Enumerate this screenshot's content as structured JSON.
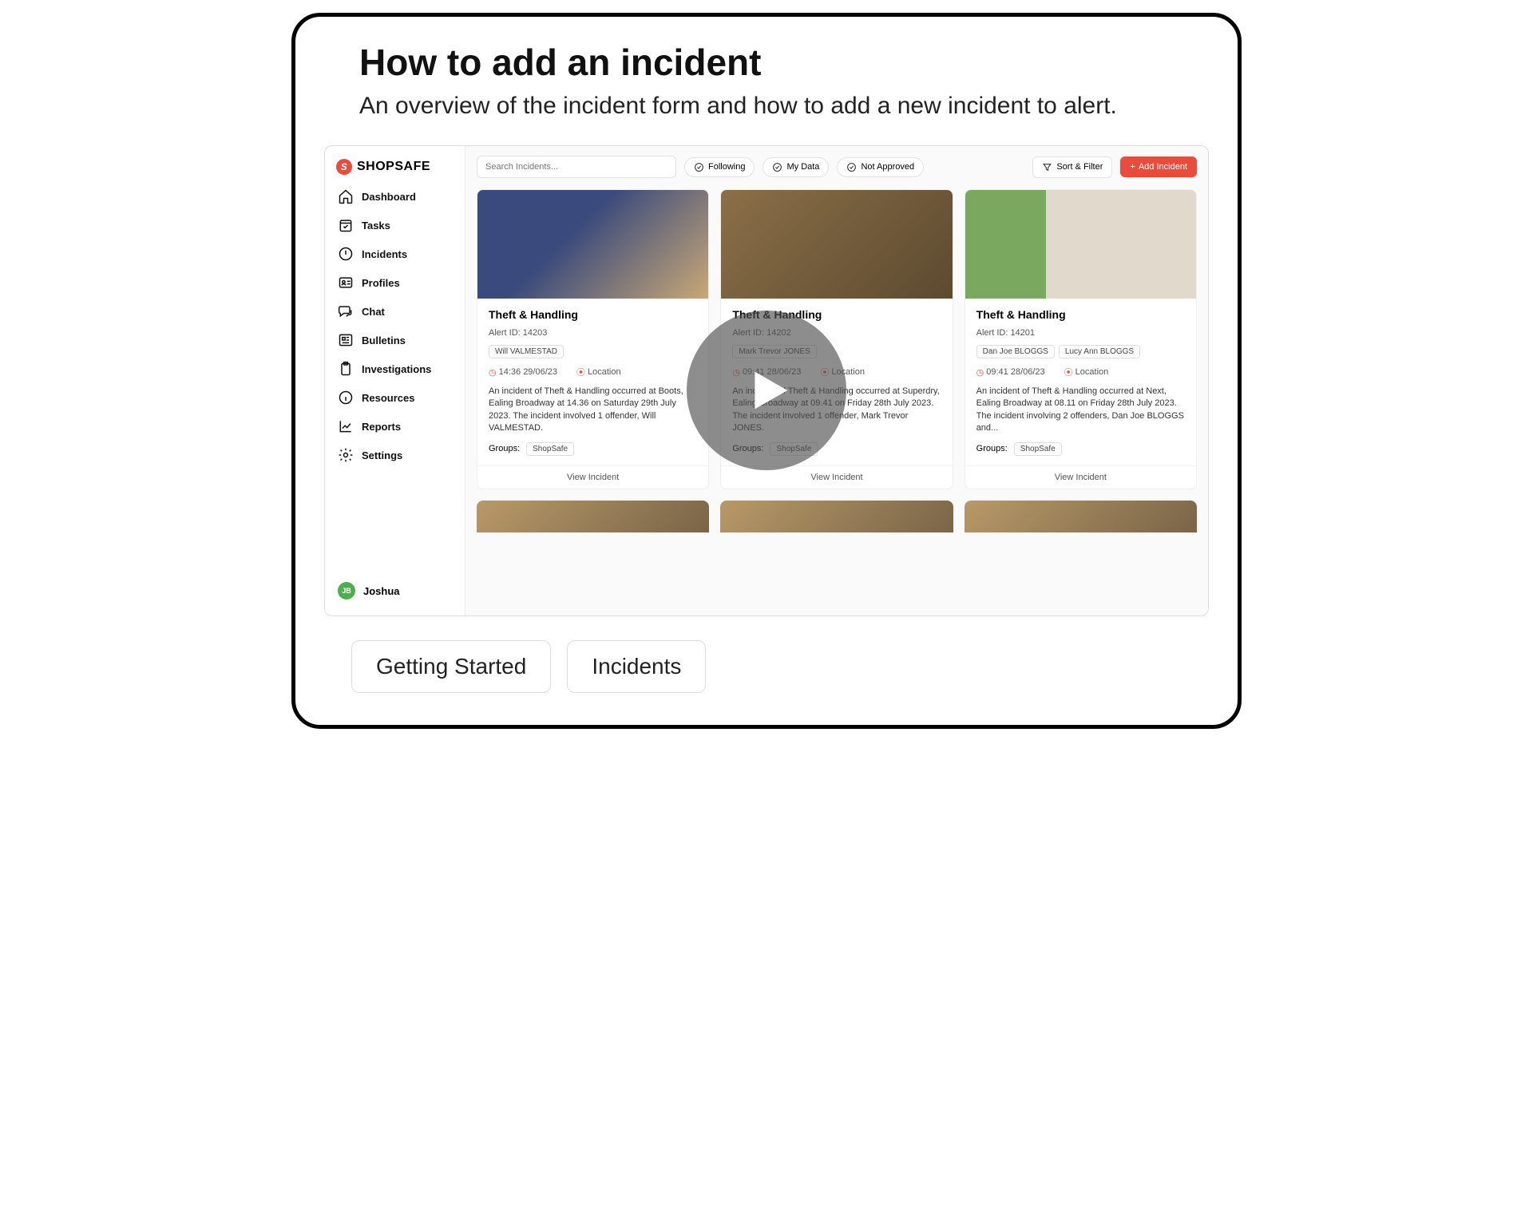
{
  "title": "How to add an incident",
  "subtitle": "An overview of the incident form and how to add a new incident to alert.",
  "brand": "SHOPSAFE",
  "nav": {
    "dashboard": "Dashboard",
    "tasks": "Tasks",
    "incidents": "Incidents",
    "profiles": "Profiles",
    "chat": "Chat",
    "bulletins": "Bulletins",
    "investigations": "Investigations",
    "resources": "Resources",
    "reports": "Reports",
    "settings": "Settings"
  },
  "user": {
    "initials": "JB",
    "name": "Joshua"
  },
  "toolbar": {
    "search_placeholder": "Search Incidents...",
    "following": "Following",
    "mydata": "My Data",
    "notapproved": "Not Approved",
    "sort": "Sort & Filter",
    "add": "Add Incident"
  },
  "cards": [
    {
      "title": "Theft & Handling",
      "id_label": "Alert ID: 14203",
      "tags": [
        "Will VALMESTAD"
      ],
      "time": "14:36  29/06/23",
      "loc": "Location",
      "desc": "An incident of Theft & Handling occurred at Boots, Ealing Broadway at 14.36 on Saturday 29th July 2023. The incident involved 1 offender, Will VALMESTAD.",
      "groups_label": "Groups:",
      "group": "ShopSafe",
      "view": "View Incident"
    },
    {
      "title": "Theft & Handling",
      "id_label": "Alert ID: 14202",
      "tags": [
        "Mark Trevor JONES"
      ],
      "time": "09:41  28/06/23",
      "loc": "Location",
      "desc": "An incident of Theft & Handling occurred at Superdry, Ealing Broadway at 09.41 on Friday 28th July 2023. The incident involved 1 offender, Mark Trevor JONES.",
      "groups_label": "Groups:",
      "group": "ShopSafe",
      "view": "View Incident"
    },
    {
      "title": "Theft & Handling",
      "id_label": "Alert ID: 14201",
      "tags": [
        "Dan Joe BLOGGS",
        "Lucy Ann BLOGGS"
      ],
      "time": "09:41  28/06/23",
      "loc": "Location",
      "desc": "An incident of Theft & Handling occurred at Next, Ealing Broadway at 08.11 on Friday 28th July 2023. The incident involving 2 offenders, Dan Joe BLOGGS and...",
      "groups_label": "Groups:",
      "group": "ShopSafe",
      "view": "View Incident"
    }
  ],
  "bottom": {
    "getting_started": "Getting Started",
    "incidents": "Incidents"
  }
}
